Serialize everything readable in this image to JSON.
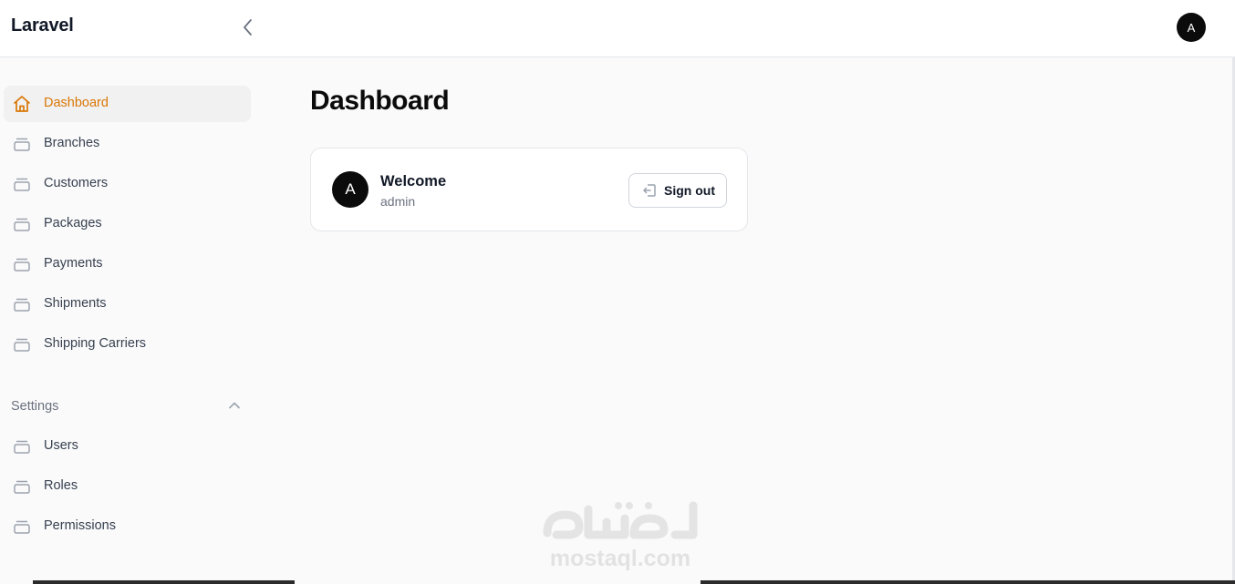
{
  "header": {
    "brand": "Laravel",
    "collapse_icon": "chevron-left-icon",
    "user_initial": "A"
  },
  "sidebar": {
    "items": [
      {
        "label": "Dashboard",
        "icon": "home-icon",
        "active": true
      },
      {
        "label": "Branches",
        "icon": "stack-icon"
      },
      {
        "label": "Customers",
        "icon": "stack-icon"
      },
      {
        "label": "Packages",
        "icon": "stack-icon"
      },
      {
        "label": "Payments",
        "icon": "stack-icon"
      },
      {
        "label": "Shipments",
        "icon": "stack-icon"
      },
      {
        "label": "Shipping Carriers",
        "icon": "stack-icon"
      }
    ],
    "settings_group": {
      "label": "Settings",
      "icon": "chevron-up-icon",
      "items": [
        {
          "label": "Users",
          "icon": "stack-icon"
        },
        {
          "label": "Roles",
          "icon": "stack-icon"
        },
        {
          "label": "Permissions",
          "icon": "stack-icon"
        }
      ]
    }
  },
  "main": {
    "title": "Dashboard",
    "account_card": {
      "avatar_initial": "A",
      "heading": "Welcome",
      "username": "admin",
      "sign_out_label": "Sign out",
      "sign_out_icon": "sign-out-icon"
    }
  },
  "watermark": {
    "arabic": "مستقل",
    "latin": "mostaql.com"
  },
  "colors": {
    "accent": "#d97706",
    "background": "#fafafa",
    "avatar": "#0b0b0b"
  }
}
